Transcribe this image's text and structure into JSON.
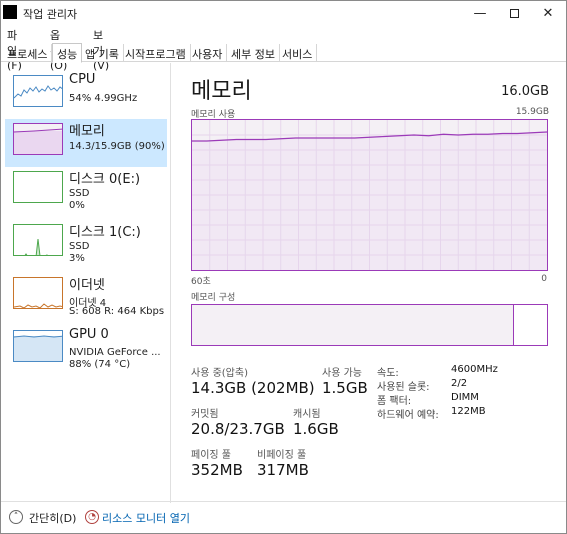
{
  "window": {
    "title": "작업 관리자",
    "min": "—",
    "close": "✕"
  },
  "menu": [
    "파일(F)",
    "옵션(O)",
    "보기(V)"
  ],
  "tabs": [
    "프로세스",
    "성능",
    "앱 기록",
    "시작프로그램",
    "사용자",
    "세부 정보",
    "서비스"
  ],
  "active_tab": "성능",
  "sidebar": {
    "items": [
      {
        "title": "CPU",
        "sub1": "54% 4.99GHz",
        "sub2": ""
      },
      {
        "title": "메모리",
        "sub1": "14.3/15.9GB (90%)",
        "sub2": ""
      },
      {
        "title": "디스크 0(E:)",
        "sub1": "SSD",
        "sub2": "0%"
      },
      {
        "title": "디스크 1(C:)",
        "sub1": "SSD",
        "sub2": "3%"
      },
      {
        "title": "이더넷",
        "sub1": "이더넷 4",
        "sub2": "S: 608  R: 464 Kbps"
      },
      {
        "title": "GPU 0",
        "sub1": "NVIDIA GeForce ...",
        "sub2": "88% (74 °C)"
      }
    ]
  },
  "main": {
    "title": "메모리",
    "total": "16.0GB",
    "usage_label": "메모리 사용",
    "usage_max": "15.9GB",
    "time_left": "60초",
    "time_right": "0",
    "composition_label": "메모리 구성",
    "composition_in_use_fraction": 0.905,
    "usage_history_fractions": [
      0.86,
      0.86,
      0.865,
      0.87,
      0.87,
      0.87,
      0.875,
      0.88,
      0.88,
      0.88,
      0.88,
      0.88,
      0.885,
      0.89,
      0.895,
      0.9,
      0.895,
      0.905,
      0.9,
      0.905,
      0.905,
      0.91,
      0.91,
      0.915,
      0.92
    ],
    "stats": {
      "in_use_label": "사용 중(압축)",
      "in_use_value": "14.3GB (202MB)",
      "available_label": "사용 가능",
      "available_value": "1.5GB",
      "committed_label": "커밋됨",
      "committed_value": "20.8/23.7GB",
      "cached_label": "캐시됨",
      "cached_value": "1.6GB",
      "paged_label": "페이징 풀",
      "paged_value": "352MB",
      "nonpaged_label": "비페이징 풀",
      "nonpaged_value": "317MB"
    },
    "details": [
      {
        "label": "속도:",
        "value": "4600MHz"
      },
      {
        "label": "사용된 슬롯:",
        "value": "2/2"
      },
      {
        "label": "폼 팩터:",
        "value": "DIMM"
      },
      {
        "label": "하드웨어 예약:",
        "value": "122MB"
      }
    ]
  },
  "bottom": {
    "fewer_details": "간단히(D)",
    "resource_monitor": "리소스 모니터 열기"
  },
  "colors": {
    "memory": "#9b3ab8",
    "selected": "#cce8ff",
    "cpu": "#4b8ac4",
    "disk": "#4da74d",
    "ethernet": "#c8752b"
  }
}
